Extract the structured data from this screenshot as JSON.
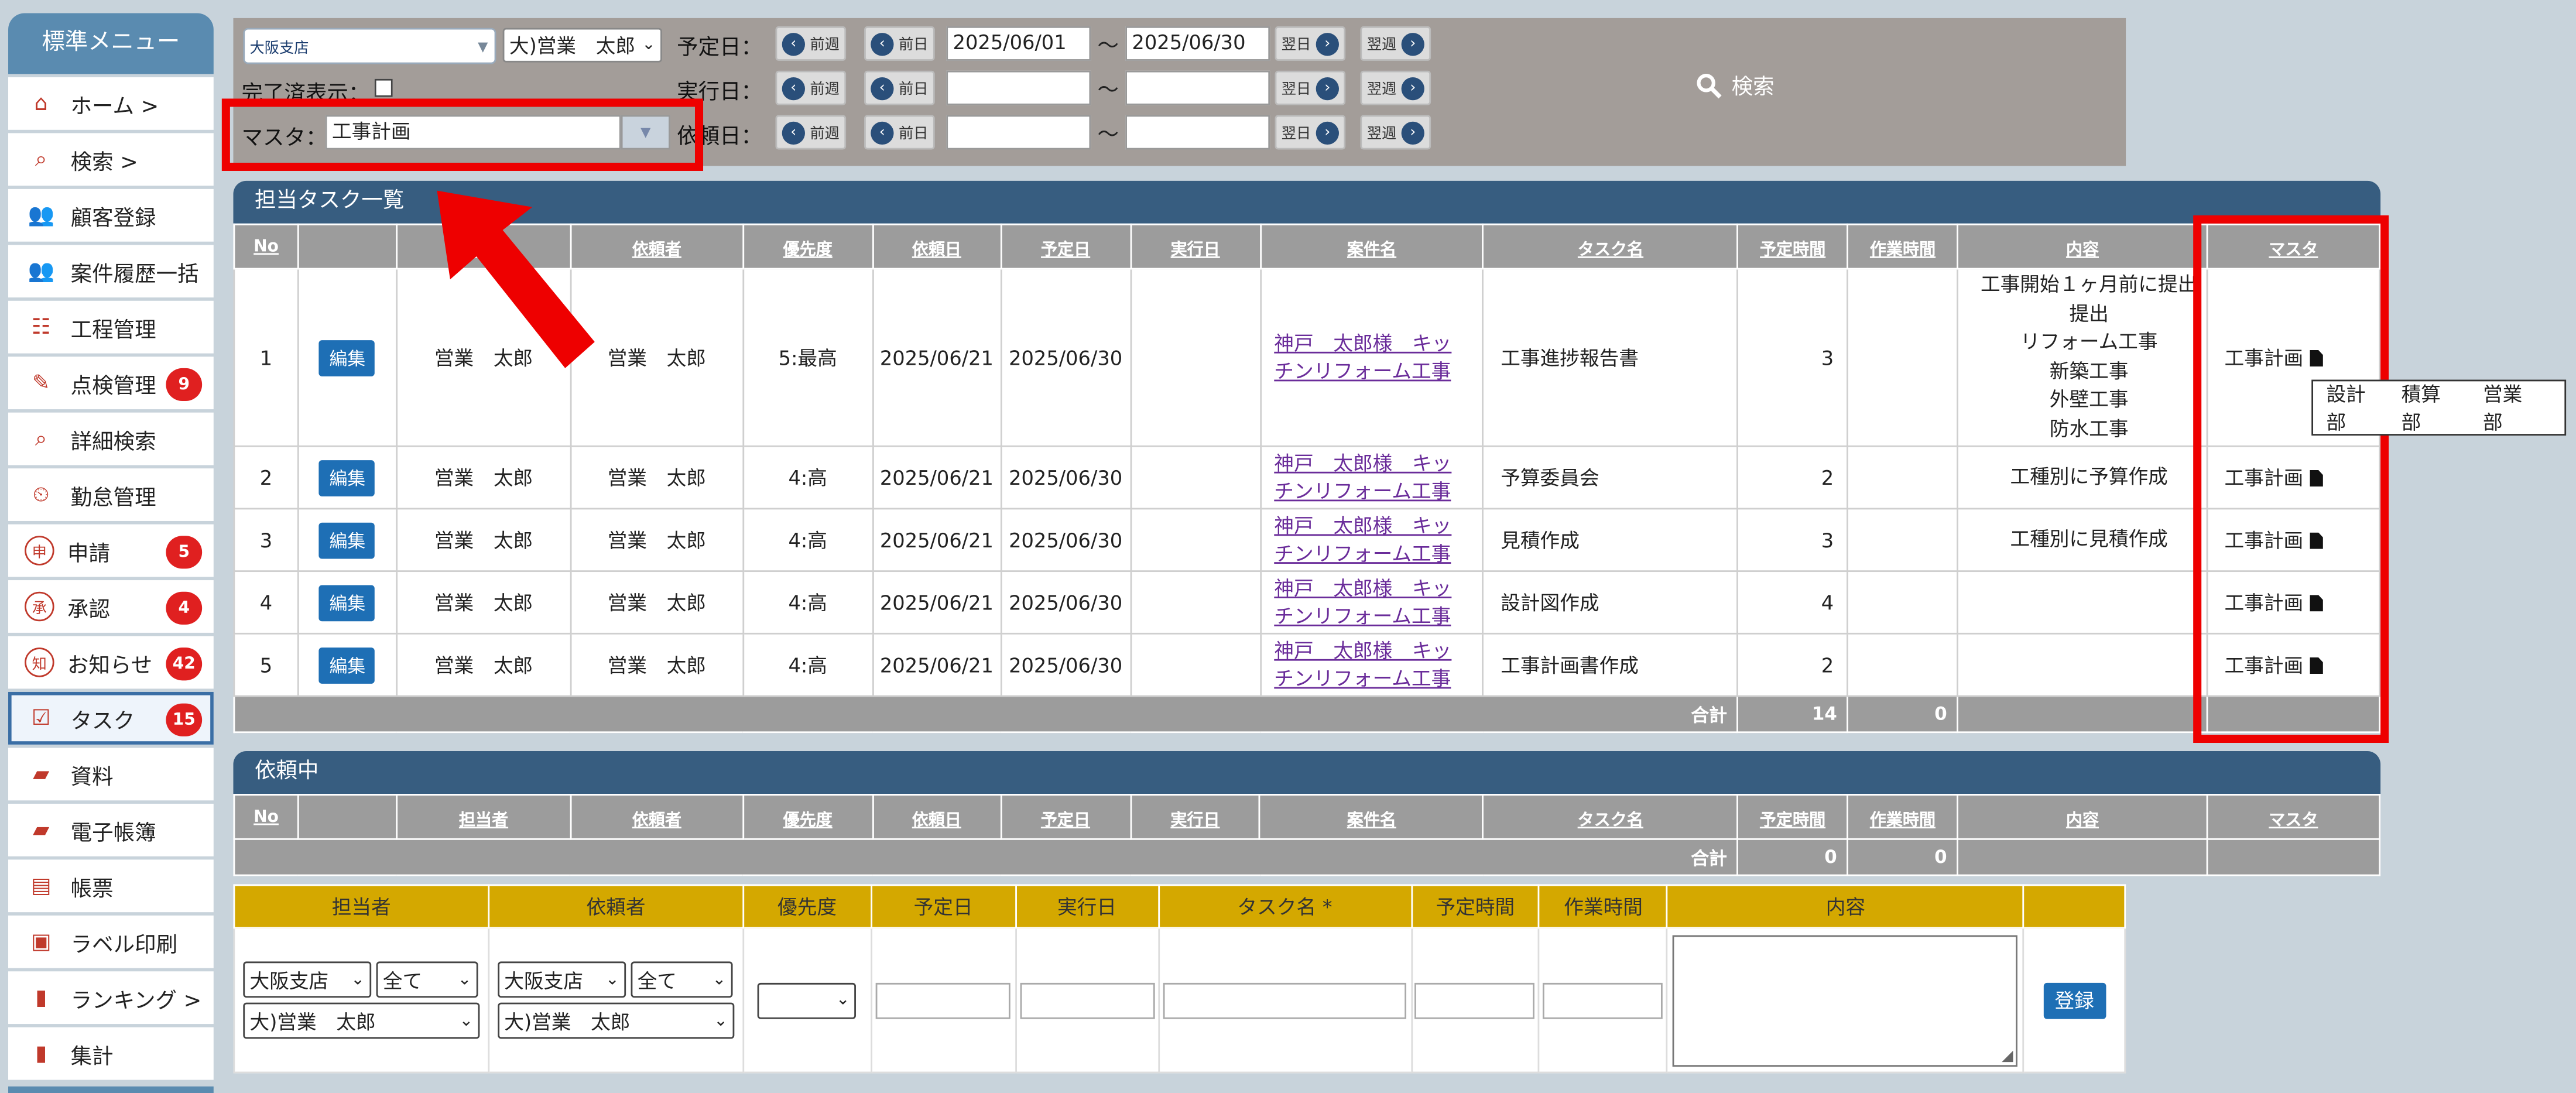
{
  "sidebar": {
    "title": "標準メニュー",
    "items": [
      {
        "label": "ホーム >",
        "icon": "home-icon"
      },
      {
        "label": "検索 >",
        "icon": "search-doc-icon"
      },
      {
        "label": "顧客登録",
        "icon": "people-icon"
      },
      {
        "label": "案件履歴一括",
        "icon": "people-icon"
      },
      {
        "label": "工程管理",
        "icon": "gantt-icon"
      },
      {
        "label": "点検管理",
        "icon": "check-doc-icon",
        "badge": "9"
      },
      {
        "label": "詳細検索",
        "icon": "search-doc-icon"
      },
      {
        "label": "勤怠管理",
        "icon": "clock-icon"
      },
      {
        "label": "申請",
        "icon": "apply-icon",
        "badge": "5"
      },
      {
        "label": "承認",
        "icon": "approve-icon",
        "badge": "4"
      },
      {
        "label": "お知らせ",
        "icon": "notice-icon",
        "badge": "42"
      },
      {
        "label": "タスク",
        "icon": "task-icon",
        "badge": "15"
      },
      {
        "label": "資料",
        "icon": "folder-icon"
      },
      {
        "label": "電子帳簿",
        "icon": "folder-icon"
      },
      {
        "label": "帳票",
        "icon": "form-icon"
      },
      {
        "label": "ラベル印刷",
        "icon": "label-icon"
      },
      {
        "label": "ランキング >",
        "icon": "bar-chart-icon"
      },
      {
        "label": "集計",
        "icon": "bar-chart-icon"
      }
    ]
  },
  "filter": {
    "branch": "大阪支店",
    "person": "大)営業　太郎",
    "done_label": "完了済表示：",
    "master_label": "マスタ：",
    "master_value": "工事計画",
    "rows": [
      {
        "label": "予定日：",
        "from": "2025/06/01",
        "to": "2025/06/30"
      },
      {
        "label": "実行日：",
        "from": "",
        "to": ""
      },
      {
        "label": "依頼日：",
        "from": "",
        "to": ""
      }
    ],
    "prev_week": "前週",
    "prev_day": "前日",
    "next_day": "翌日",
    "next_week": "翌週",
    "tilde": "～",
    "search": "検索"
  },
  "tasks": {
    "title": "担当タスク一覧",
    "headers": [
      "No",
      "",
      "担当者",
      "依頼者",
      "優先度",
      "依頼日",
      "予定日",
      "実行日",
      "案件名",
      "タスク名",
      "予定時間",
      "作業時間",
      "内容",
      "マスタ"
    ],
    "edit_label": "編集",
    "rows": [
      {
        "no": "1",
        "assignee": "営業　太郎",
        "requester": "営業　太郎",
        "priority": "5:最高",
        "req_date": "2025/06/21",
        "due_date": "2025/06/30",
        "exec_date": "",
        "project": "神戸　太郎様　キッチンリフォーム工事",
        "task": "工事進捗報告書",
        "plan_time": "3",
        "work_time": "",
        "content": [
          "工事開始１ヶ月前に提出",
          "提出",
          "リフォーム工事",
          "新築工事",
          "外壁工事",
          "防水工事"
        ],
        "master": "工事計画"
      },
      {
        "no": "2",
        "assignee": "営業　太郎",
        "requester": "営業　太郎",
        "priority": "4:高",
        "req_date": "2025/06/21",
        "due_date": "2025/06/30",
        "exec_date": "",
        "project": "神戸　太郎様　キッチンリフォーム工事",
        "task": "予算委員会",
        "plan_time": "2",
        "work_time": "",
        "content": [
          "工種別に予算作成"
        ],
        "master": "工事計画"
      },
      {
        "no": "3",
        "assignee": "営業　太郎",
        "requester": "営業　太郎",
        "priority": "4:高",
        "req_date": "2025/06/21",
        "due_date": "2025/06/30",
        "exec_date": "",
        "project": "神戸　太郎様　キッチンリフォーム工事",
        "task": "見積作成",
        "plan_time": "3",
        "work_time": "",
        "content": [
          "工種別に見積作成"
        ],
        "master": "工事計画"
      },
      {
        "no": "4",
        "assignee": "営業　太郎",
        "requester": "営業　太郎",
        "priority": "4:高",
        "req_date": "2025/06/21",
        "due_date": "2025/06/30",
        "exec_date": "",
        "project": "神戸　太郎様　キッチンリフォーム工事",
        "task": "設計図作成",
        "plan_time": "4",
        "work_time": "",
        "content": [],
        "master": "工事計画"
      },
      {
        "no": "5",
        "assignee": "営業　太郎",
        "requester": "営業　太郎",
        "priority": "4:高",
        "req_date": "2025/06/21",
        "due_date": "2025/06/30",
        "exec_date": "",
        "project": "神戸　太郎様　キッチンリフォーム工事",
        "task": "工事計画書作成",
        "plan_time": "2",
        "work_time": "",
        "content": [],
        "master": "工事計画"
      }
    ],
    "total_label": "合計",
    "total_plan": "14",
    "total_work": "0"
  },
  "tooltip": [
    "設計部",
    "積算部",
    "営業部"
  ],
  "requested": {
    "title": "依頼中",
    "headers": [
      "No",
      "",
      "担当者",
      "依頼者",
      "優先度",
      "依頼日",
      "予定日",
      "実行日",
      "案件名",
      "タスク名",
      "予定時間",
      "作業時間",
      "内容",
      "マスタ"
    ],
    "total_label": "合計",
    "total_plan": "0",
    "total_work": "0"
  },
  "form": {
    "headers": [
      "担当者",
      "依頼者",
      "優先度",
      "予定日",
      "実行日",
      "タスク名 *",
      "予定時間",
      "作業時間",
      "内容",
      ""
    ],
    "assignee_branch": "大阪支店",
    "assignee_scope": "全て",
    "assignee_person": "大)営業　太郎",
    "requester_branch": "大阪支店",
    "requester_scope": "全て",
    "requester_person": "大)営業　太郎",
    "priority": "",
    "register": "登録"
  }
}
